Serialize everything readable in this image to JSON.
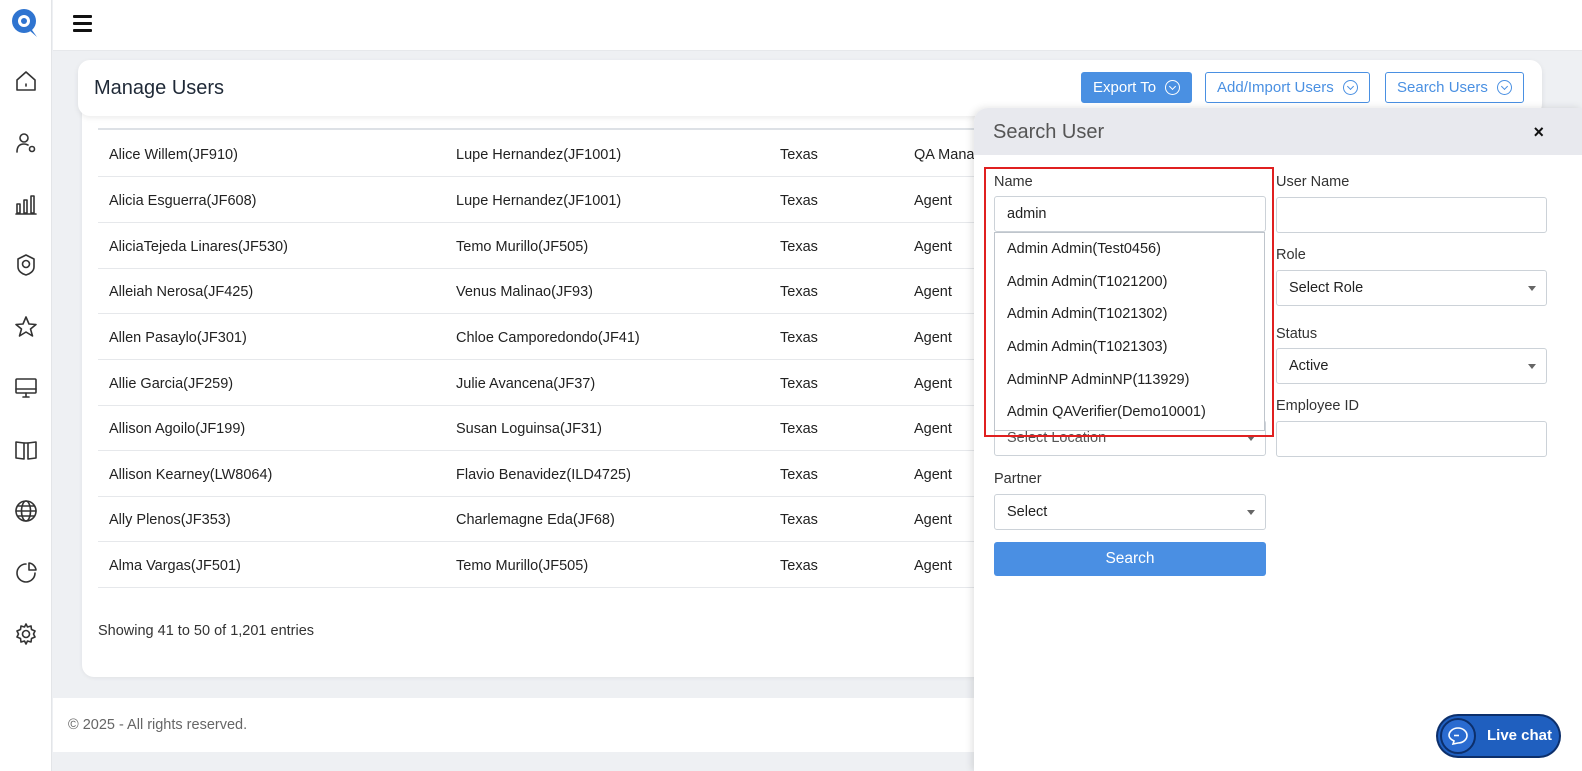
{
  "header": {
    "title": "Manage Users",
    "export_label": "Export To",
    "add_import_label": "Add/Import Users",
    "search_users_label": "Search Users"
  },
  "colors": {
    "accent": "#4a90e2",
    "highlight": "#e02020",
    "livechat": "#1f5fbf"
  },
  "sidebar": {
    "icons": [
      "home-icon",
      "user-settings-icon",
      "bar-chart-icon",
      "badge-icon",
      "star-icon",
      "monitor-icon",
      "book-icon",
      "globe-icon",
      "pie-chart-icon",
      "gear-icon"
    ]
  },
  "table": {
    "rows": [
      [
        "Alice Willem(JF910)",
        "Lupe Hernandez(JF1001)",
        "Texas",
        "QA Mana"
      ],
      [
        "Alicia Esguerra(JF608)",
        "Lupe Hernandez(JF1001)",
        "Texas",
        "Agent"
      ],
      [
        "AliciaTejeda Linares(JF530)",
        "Temo Murillo(JF505)",
        "Texas",
        "Agent"
      ],
      [
        "Alleiah Nerosa(JF425)",
        "Venus Malinao(JF93)",
        "Texas",
        "Agent"
      ],
      [
        "Allen Pasaylo(JF301)",
        "Chloe Camporedondo(JF41)",
        "Texas",
        "Agent"
      ],
      [
        "Allie Garcia(JF259)",
        "Julie Avancena(JF37)",
        "Texas",
        "Agent"
      ],
      [
        "Allison Agoilo(JF199)",
        "Susan Loguinsa(JF31)",
        "Texas",
        "Agent"
      ],
      [
        "Allison Kearney(LW8064)",
        "Flavio Benavidez(ILD4725)",
        "Texas",
        "Agent"
      ],
      [
        "Ally Plenos(JF353)",
        "Charlemagne Eda(JF68)",
        "Texas",
        "Agent"
      ],
      [
        "Alma Vargas(JF501)",
        "Temo Murillo(JF505)",
        "Texas",
        "Agent"
      ]
    ],
    "showing": "Showing 41 to 50 of 1,201 entries"
  },
  "footer": {
    "copyright": "© 2025 - All rights reserved."
  },
  "search_panel": {
    "title": "Search User",
    "close": "×",
    "name_label": "Name",
    "name_value": "admin",
    "suggestions": [
      "Admin Admin(Test0456)",
      "Admin Admin(T1021200)",
      "Admin Admin(T1021302)",
      "Admin Admin(T1021303)",
      "AdminNP AdminNP(113929)",
      "Admin QAVerifier(Demo10001)"
    ],
    "location_value": "Select Location",
    "partner_label": "Partner",
    "partner_value": "Select",
    "username_label": "User Name",
    "username_value": "",
    "role_label": "Role",
    "role_value": "Select Role",
    "status_label": "Status",
    "status_value": "Active",
    "employee_id_label": "Employee ID",
    "employee_id_value": "",
    "search_button": "Search"
  },
  "livechat": {
    "label": "Live chat"
  }
}
